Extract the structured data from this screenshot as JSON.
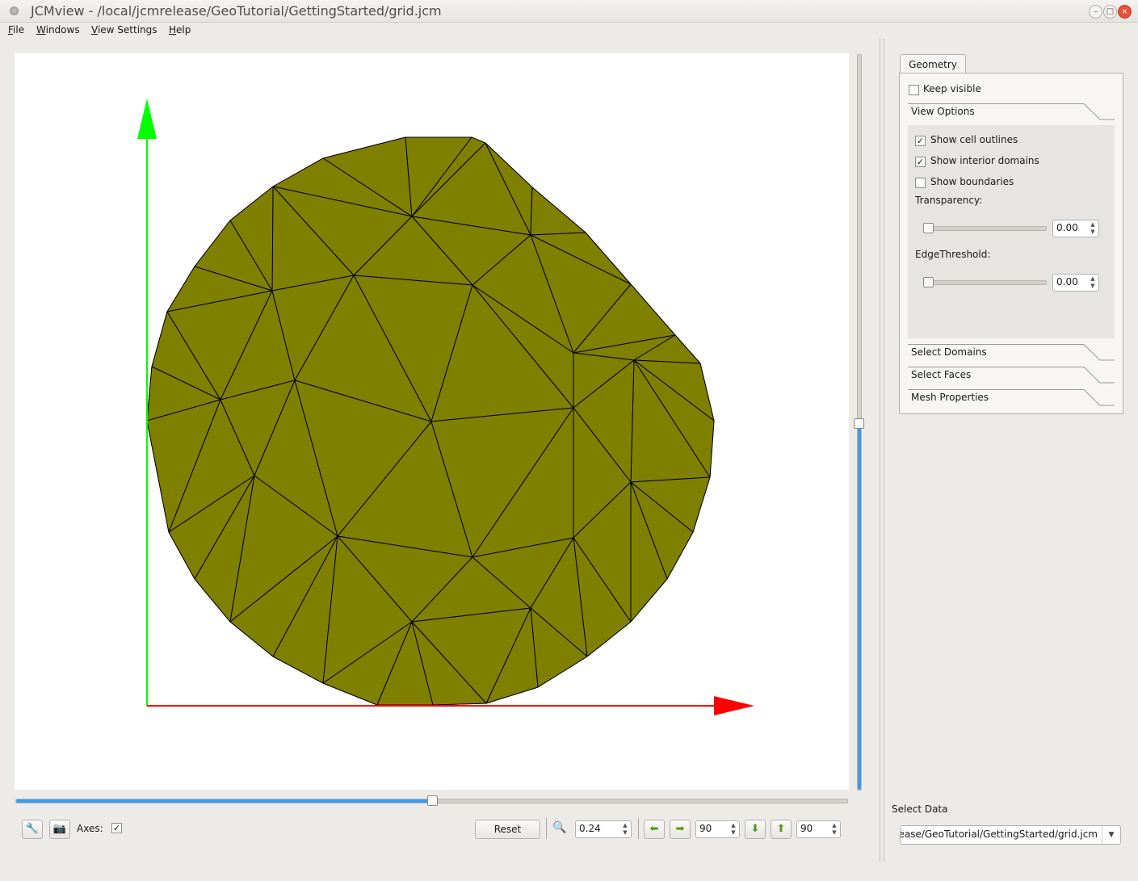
{
  "window": {
    "title": "JCMview - /local/jcmrelease/GeoTutorial/GettingStarted/grid.jcm",
    "controls": {
      "minimize": "–",
      "maximize": "□",
      "close": "×"
    }
  },
  "menubar": {
    "items": [
      {
        "mnemonic": "F",
        "rest": "ile"
      },
      {
        "mnemonic": "W",
        "rest": "indows"
      },
      {
        "mnemonic": "V",
        "rest": "iew Settings"
      },
      {
        "mnemonic": "H",
        "rest": "elp"
      }
    ]
  },
  "viewport": {
    "background": "#ffffff",
    "mesh_fill": "#808000",
    "mesh_edge": "#000000",
    "x_axis_color": "#ff0000",
    "y_axis_color": "#00ff00",
    "horizontal_slider_fraction": 0.5,
    "vertical_slider_fraction": 0.5
  },
  "toolbar": {
    "wrench_icon": "🔧",
    "camera_icon": "📷",
    "axes_label": "Axes:",
    "axes_checked": true,
    "reset_label": "Reset",
    "zoom_icon": "🔍",
    "zoom_value": "0.24",
    "left_arrow_icon": "⬅",
    "right_arrow_icon": "➡",
    "horizontal_angle": "90",
    "down_arrow_icon": "⬇",
    "up_arrow_icon": "⬆",
    "vertical_angle": "90",
    "arrow_icon_color": "#4f9a1a"
  },
  "sidepanel": {
    "tab_label": "Geometry",
    "keep_visible_label": "Keep visible",
    "keep_visible_checked": false,
    "view_options_label": "View Options",
    "show_cell_outlines_label": "Show cell outlines",
    "show_cell_outlines_checked": true,
    "show_interior_domains_label": "Show interior domains",
    "show_interior_domains_checked": true,
    "show_boundaries_label": "Show boundaries",
    "show_boundaries_checked": false,
    "transparency_label": "Transparency:",
    "transparency_value": "0.00",
    "edge_threshold_label": "EdgeThreshold:",
    "edge_threshold_value": "0.00",
    "select_domains_label": "Select Domains",
    "select_faces_label": "Select Faces",
    "mesh_properties_label": "Mesh Properties"
  },
  "select_data": {
    "label": "Select Data",
    "value": "ease/GeoTutorial/GettingStarted/grid.jcm"
  }
}
